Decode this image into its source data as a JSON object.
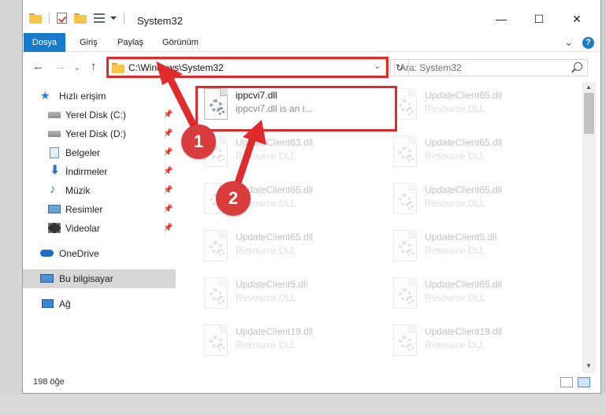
{
  "window": {
    "title": "System32",
    "minimize_glyph": "—",
    "maximize_glyph": "☐",
    "close_glyph": "✕"
  },
  "ribbon": {
    "tabs": [
      "Dosya",
      "Giriş",
      "Paylaş",
      "Görünüm"
    ],
    "expand_glyph": "⌄",
    "help_glyph": "?"
  },
  "nav": {
    "back_glyph": "←",
    "forward_glyph": "→",
    "recent_glyph": "⌄",
    "up_glyph": "↑",
    "address": "C:\\Windows\\System32",
    "address_chevron": "⌄",
    "refresh_glyph": "↻",
    "search_placeholder": "Ara: System32"
  },
  "sidebar": {
    "items": [
      {
        "label": "Hızlı erişim",
        "icon": "star-icon",
        "pinned": false
      },
      {
        "label": "Yerel Disk (C:)",
        "icon": "disk-icon",
        "pinned": true
      },
      {
        "label": "Yerel Disk (D:)",
        "icon": "disk-icon",
        "pinned": true
      },
      {
        "label": "Belgeler",
        "icon": "document-icon",
        "pinned": true
      },
      {
        "label": "İndirmeler",
        "icon": "download-icon",
        "pinned": true
      },
      {
        "label": "Müzik",
        "icon": "music-icon",
        "pinned": true
      },
      {
        "label": "Resimler",
        "icon": "picture-icon",
        "pinned": true
      },
      {
        "label": "Videolar",
        "icon": "video-icon",
        "pinned": true
      },
      {
        "label": "OneDrive",
        "icon": "cloud-icon",
        "pinned": false
      },
      {
        "label": "Bu bilgisayar",
        "icon": "computer-icon",
        "pinned": false,
        "selected": true
      },
      {
        "label": "Ağ",
        "icon": "network-icon",
        "pinned": false
      }
    ],
    "pin_glyph": "📌"
  },
  "files": [
    {
      "name": "ippcvi7.dll",
      "desc": "ippcvi7.dll is an i...",
      "highlighted": true
    },
    {
      "name": "UpdateClient65.dll",
      "desc": "Resource DLL"
    },
    {
      "name": "UpdateClient63.dll",
      "desc": "Resource DLL"
    },
    {
      "name": "UpdateClient65.dll",
      "desc": "Resource DLL"
    },
    {
      "name": "UpdateClient65.dll",
      "desc": "Resource DLL"
    },
    {
      "name": "UpdateClient65.dll",
      "desc": "Resource DLL"
    },
    {
      "name": "UpdateClient65.dll",
      "desc": "Resource DLL"
    },
    {
      "name": "UpdateClient5.dll",
      "desc": "Resource DLL"
    },
    {
      "name": "UpdateClient5.dll",
      "desc": "Resource DLL"
    },
    {
      "name": "UpdateClient65.dll",
      "desc": "Resource DLL"
    },
    {
      "name": "UpdateClient19.dll",
      "desc": "Resource DLL"
    },
    {
      "name": "UpdateClient19.dll",
      "desc": "Resource DLL"
    }
  ],
  "status": {
    "item_count": "198 öğe"
  },
  "annotations": {
    "step1": "1",
    "step2": "2",
    "color": "#df2b2b"
  }
}
